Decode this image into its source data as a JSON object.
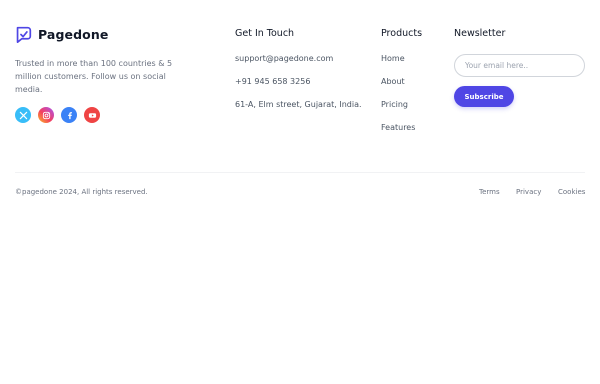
{
  "brand": {
    "name": "Pagedone",
    "color": "#4f46e5"
  },
  "tagline": "Trusted in more than 100 countries & 5 million customers. Follow us on social media.",
  "socials": [
    {
      "icon": "x-twitter-icon",
      "color": "#38bdf8"
    },
    {
      "icon": "instagram-icon",
      "color": "#e1306c"
    },
    {
      "icon": "facebook-icon",
      "color": "#3b82f6"
    },
    {
      "icon": "youtube-icon",
      "color": "#ef4444"
    }
  ],
  "contact": {
    "title": "Get In Touch",
    "email": "support@pagedone.com",
    "phone": "+91 945 658 3256",
    "address": "61-A, Elm street, Gujarat, India."
  },
  "products": {
    "title": "Products",
    "items": [
      "Home",
      "About",
      "Pricing",
      "Features"
    ]
  },
  "newsletter": {
    "title": "Newsletter",
    "placeholder": "Your email here..",
    "button": "Subscribe",
    "button_color": "#4f46e5"
  },
  "bottom": {
    "copyright": "©pagedone 2024, All rights reserved.",
    "links": [
      "Terms",
      "Privacy",
      "Cookies"
    ]
  }
}
